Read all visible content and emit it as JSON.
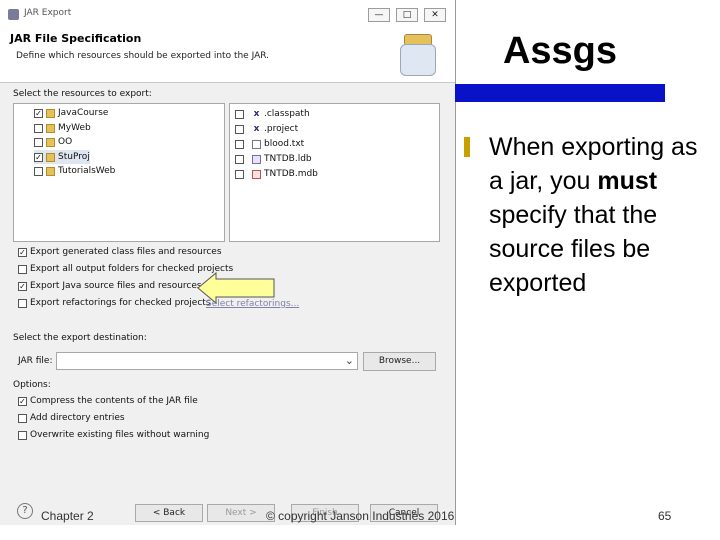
{
  "dialog": {
    "window_title": "JAR Export",
    "header_title": "JAR File Specification",
    "header_description": "Define which resources should be exported into the JAR.",
    "resources_label": "Select the resources to export:",
    "tree_items": [
      {
        "label": "JavaCourse",
        "checked": "✓"
      },
      {
        "label": "MyWeb",
        "checked": ""
      },
      {
        "label": "OO",
        "checked": ""
      },
      {
        "label": "StuProj",
        "checked": "✓"
      },
      {
        "label": "TutorialsWeb",
        "checked": ""
      }
    ],
    "file_items": [
      {
        "label": ".classpath",
        "checked": ""
      },
      {
        "label": ".project",
        "checked": ""
      },
      {
        "label": "blood.txt",
        "checked": ""
      },
      {
        "label": "TNTDB.ldb",
        "checked": ""
      },
      {
        "label": "TNTDB.mdb",
        "checked": ""
      }
    ],
    "export_options": [
      {
        "label": "Export generated class files and resources",
        "checked": "✓"
      },
      {
        "label": "Export all output folders for checked projects",
        "checked": ""
      },
      {
        "label": "Export Java source files and resources",
        "checked": "✓"
      },
      {
        "label": "Export refactorings for checked projects",
        "checked": ""
      }
    ],
    "select_refactorings_link": "Select refactorings...",
    "destination_label": "Select the export destination:",
    "jar_file_label": "JAR file:",
    "jar_file_value": "",
    "browse_button": "Browse...",
    "options_label": "Options:",
    "options": [
      {
        "label": "Compress the contents of the JAR file",
        "checked": "✓"
      },
      {
        "label": "Add directory entries",
        "checked": ""
      },
      {
        "label": "Overwrite existing files without warning",
        "checked": ""
      }
    ],
    "help_icon_text": "?",
    "back_button": "< Back",
    "next_button": "Next >",
    "finish_button": "Finish",
    "cancel_button": "Cancel"
  },
  "slide": {
    "title": "Assgs",
    "bullet_text_pre": "When exporting as a jar, you ",
    "bullet_text_bold": "must",
    "bullet_text_post": " specify that the source files be exported"
  },
  "footer": {
    "left": "Chapter 2",
    "center": "© copyright Janson Industries 2016",
    "right": "65"
  },
  "colors": {
    "title_bar": "#0a12c8",
    "bullet": "#c8a000",
    "arrow_fill": "#ffff99"
  }
}
